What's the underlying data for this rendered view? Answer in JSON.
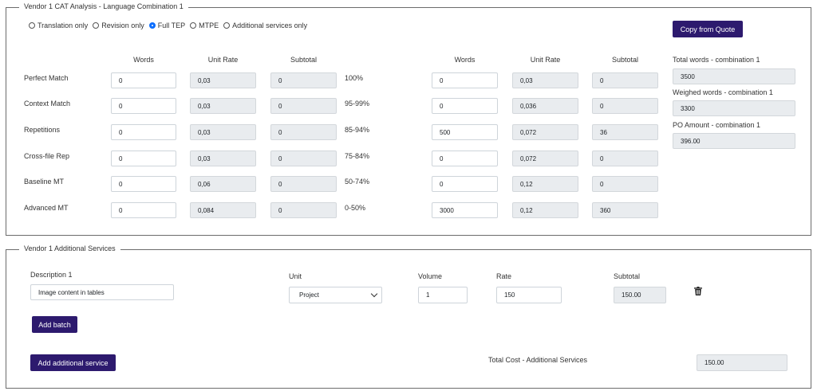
{
  "cat": {
    "legend": "Vendor 1 CAT Analysis - Language Combination 1",
    "radios": [
      {
        "label": "Translation only",
        "checked": false
      },
      {
        "label": "Revision only",
        "checked": false
      },
      {
        "label": "Full TEP",
        "checked": true
      },
      {
        "label": "MTPE",
        "checked": false
      },
      {
        "label": "Additional services only",
        "checked": false
      }
    ],
    "copy_button": "Copy from Quote",
    "left_headers": {
      "words": "Words",
      "unit_rate": "Unit Rate",
      "subtotal": "Subtotal"
    },
    "right_headers": {
      "words": "Words",
      "unit_rate": "Unit Rate",
      "subtotal": "Subtotal"
    },
    "rows": [
      {
        "label": "Perfect Match",
        "l_words": "0",
        "l_rate": "0,03",
        "l_sub": "0",
        "band": "100%",
        "r_words": "0",
        "r_rate": "0,03",
        "r_sub": "0"
      },
      {
        "label": "Context Match",
        "l_words": "0",
        "l_rate": "0,03",
        "l_sub": "0",
        "band": "95-99%",
        "r_words": "0",
        "r_rate": "0,036",
        "r_sub": "0"
      },
      {
        "label": "Repetitions",
        "l_words": "0",
        "l_rate": "0,03",
        "l_sub": "0",
        "band": "85-94%",
        "r_words": "500",
        "r_rate": "0,072",
        "r_sub": "36"
      },
      {
        "label": "Cross-file Rep",
        "l_words": "0",
        "l_rate": "0,03",
        "l_sub": "0",
        "band": "75-84%",
        "r_words": "0",
        "r_rate": "0,072",
        "r_sub": "0"
      },
      {
        "label": "Baseline MT",
        "l_words": "0",
        "l_rate": "0,06",
        "l_sub": "0",
        "band": "50-74%",
        "r_words": "0",
        "r_rate": "0,12",
        "r_sub": "0"
      },
      {
        "label": "Advanced MT",
        "l_words": "0",
        "l_rate": "0,084",
        "l_sub": "0",
        "band": "0-50%",
        "r_words": "3000",
        "r_rate": "0,12",
        "r_sub": "360"
      }
    ],
    "summary": {
      "total_words_label": "Total words - combination 1",
      "total_words": "3500",
      "weighed_words_label": "Weighed words - combination 1",
      "weighed_words": "3300",
      "po_amount_label": "PO Amount - combination 1",
      "po_amount": "396.00"
    }
  },
  "additional": {
    "legend": "Vendor 1 Additional Services",
    "description_label": "Description 1",
    "description_value": "Image content in tables",
    "unit_label": "Unit",
    "unit_value": "Project",
    "volume_label": "Volume",
    "volume_value": "1",
    "rate_label": "Rate",
    "rate_value": "150",
    "subtotal_label": "Subtotal",
    "subtotal_value": "150.00",
    "delete_icon": "trash-icon",
    "add_batch_button": "Add batch",
    "add_service_button": "Add additional service",
    "total_cost_label": "Total Cost - Additional Services",
    "total_cost_value": "150.00"
  },
  "colors": {
    "primary_button": "#2d1a6e",
    "radio_checked": "#0d6efd",
    "readonly_bg": "#e9ecef"
  }
}
